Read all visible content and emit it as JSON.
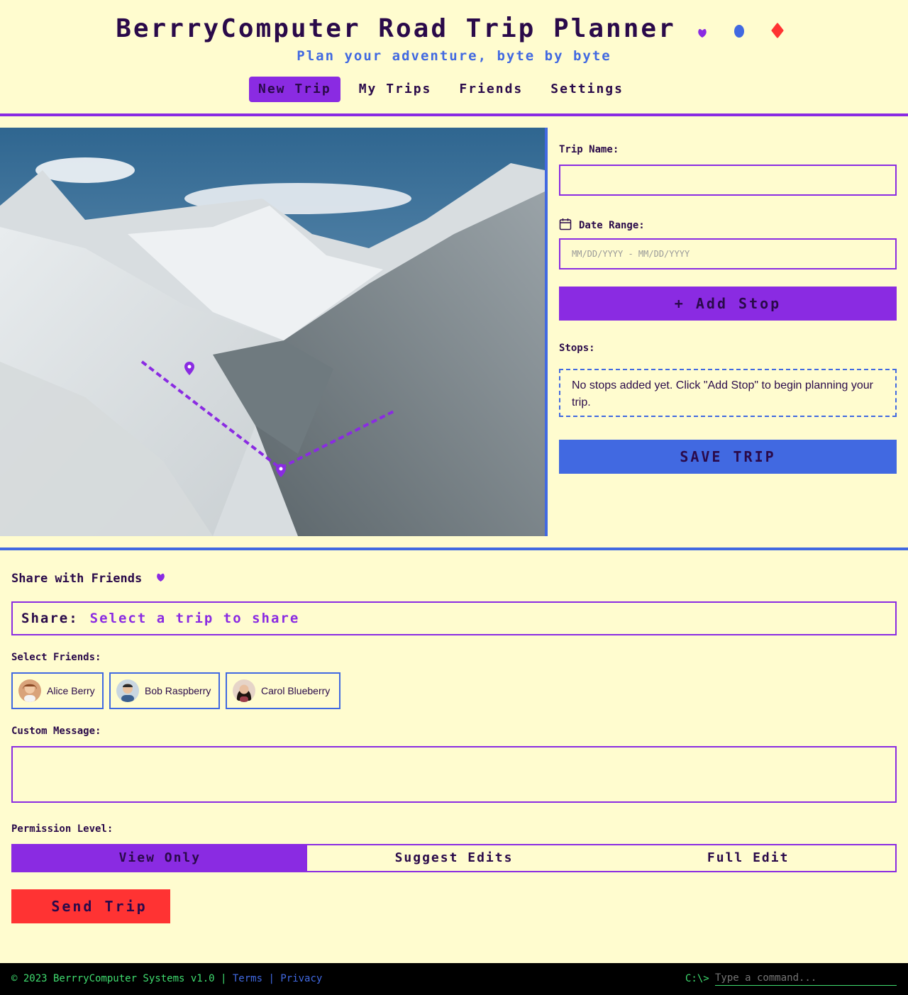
{
  "header": {
    "title": "BerrryComputer Road Trip Planner",
    "subtitle": "Plan your adventure, byte by byte",
    "nav": [
      {
        "label": "New Trip",
        "active": true
      },
      {
        "label": "My Trips",
        "active": false
      },
      {
        "label": "Friends",
        "active": false
      },
      {
        "label": "Settings",
        "active": false
      }
    ]
  },
  "colors": {
    "background": "#fffccf",
    "purple": "#8a2be2",
    "blue": "#4169e1",
    "red": "#ff3333",
    "text": "#2a0a4a",
    "terminal_green": "#3fdc6f"
  },
  "form": {
    "trip_name_label": "Trip Name:",
    "trip_name_value": "",
    "date_label": "Date Range:",
    "date_placeholder": "MM/DD/YYYY - MM/DD/YYYY",
    "add_stop_label": "+ Add Stop",
    "stops_label": "Stops:",
    "stops_empty": "No stops added yet. Click \"Add Stop\" to begin planning your trip.",
    "save_label": "SAVE TRIP"
  },
  "share": {
    "title": "Share with Friends",
    "share_prefix": "Share:",
    "share_value": "Select a trip to share",
    "friends_label": "Select Friends:",
    "friends": [
      "Alice Berry",
      "Bob Raspberry",
      "Carol Blueberry"
    ],
    "message_label": "Custom Message:",
    "message_value": "",
    "permission_label": "Permission Level:",
    "permissions": [
      {
        "label": "View Only",
        "active": true
      },
      {
        "label": "Suggest Edits",
        "active": false
      },
      {
        "label": "Full Edit",
        "active": false
      }
    ],
    "send_label": "Send Trip"
  },
  "footer": {
    "copyright": "© 2023 BerrryComputer Systems v1.0 |",
    "terms": "Terms",
    "separator": "|",
    "privacy": "Privacy",
    "prompt": "C:\\>",
    "command_placeholder": "Type a command..."
  }
}
